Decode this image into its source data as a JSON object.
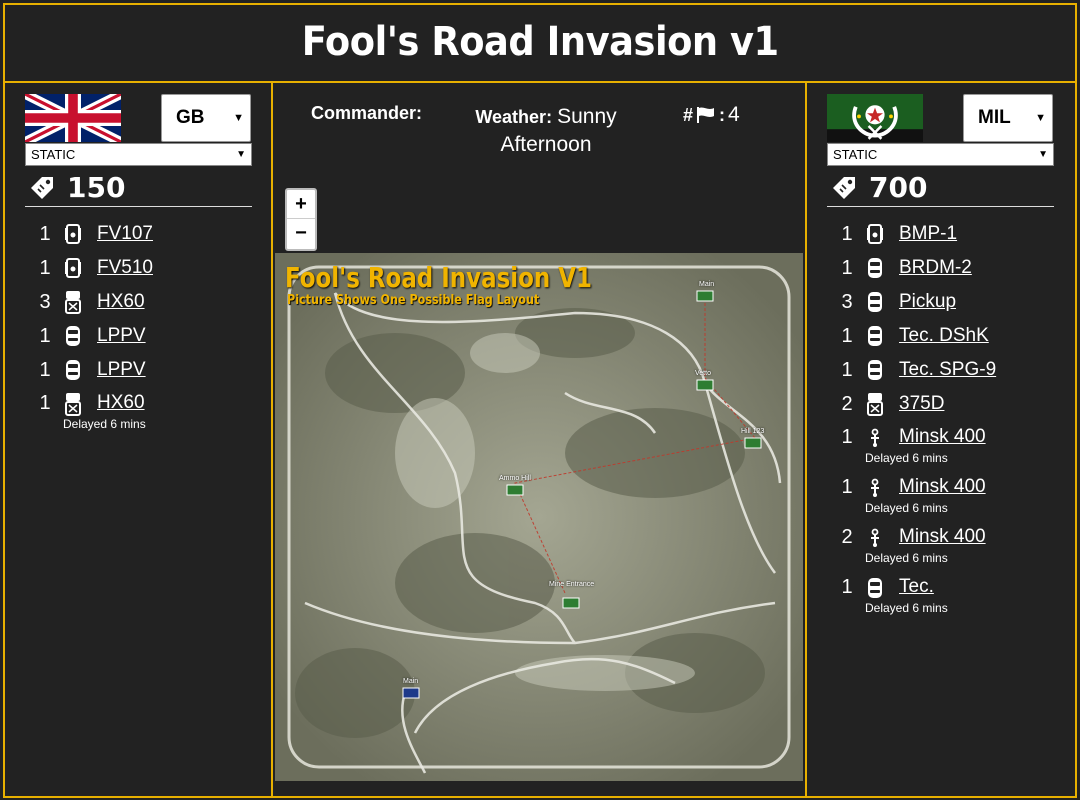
{
  "title": "Fool's Road Invasion v1",
  "left": {
    "faction": "GB",
    "mode": "STATIC",
    "points": "150",
    "units": [
      {
        "qty": "1",
        "icon": "apc-icon",
        "name": "FV107"
      },
      {
        "qty": "1",
        "icon": "apc-icon",
        "name": "FV510"
      },
      {
        "qty": "3",
        "icon": "truck-icon",
        "name": "HX60"
      },
      {
        "qty": "1",
        "icon": "car-icon",
        "name": "LPPV"
      },
      {
        "qty": "1",
        "icon": "car-icon",
        "name": "LPPV"
      },
      {
        "qty": "1",
        "icon": "truck-icon",
        "name": "HX60",
        "delay": "Delayed 6 mins"
      }
    ]
  },
  "right": {
    "faction": "MIL",
    "mode": "STATIC",
    "points": "700",
    "units": [
      {
        "qty": "1",
        "icon": "apc-icon",
        "name": "BMP-1"
      },
      {
        "qty": "1",
        "icon": "car-icon",
        "name": "BRDM-2"
      },
      {
        "qty": "3",
        "icon": "car-icon",
        "name": "Pickup"
      },
      {
        "qty": "1",
        "icon": "car-icon",
        "name": "Tec. DShK"
      },
      {
        "qty": "1",
        "icon": "car-icon",
        "name": "Tec. SPG-9"
      },
      {
        "qty": "2",
        "icon": "truck-icon",
        "name": "375D"
      },
      {
        "qty": "1",
        "icon": "motorbike-icon",
        "name": "Minsk 400",
        "delay": "Delayed 6 mins"
      },
      {
        "qty": "1",
        "icon": "motorbike-icon",
        "name": "Minsk 400",
        "delay": "Delayed 6 mins"
      },
      {
        "qty": "2",
        "icon": "motorbike-icon",
        "name": "Minsk 400",
        "delay": "Delayed 6 mins"
      },
      {
        "qty": "1",
        "icon": "car-icon",
        "name": "Tec.",
        "delay": "Delayed 6 mins"
      }
    ]
  },
  "info": {
    "commander_label": "Commander:",
    "weather_label": "Weather:",
    "weather_value": "Sunny Afternoon",
    "flags_prefix": "#",
    "flags_suffix": ":",
    "flags_value": "4"
  },
  "zoom": {
    "in": "+",
    "out": "−"
  },
  "map": {
    "title": "Fool's Road Invasion V1",
    "subtitle": "Picture Shows One Possible Flag Layout",
    "labels": [
      "Main",
      "Vetto",
      "Hill 123",
      "Ammo Hill",
      "Mine Entrance",
      "Main"
    ]
  },
  "colors": {
    "accent": "#e8b000",
    "background": "#222222",
    "map_title": "#f0b400"
  }
}
